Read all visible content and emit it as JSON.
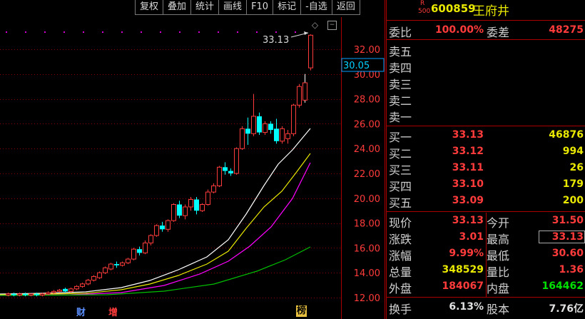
{
  "toolbar": {
    "buttons": [
      "复权",
      "叠加",
      "统计",
      "画线",
      "F10",
      "标记",
      "-自选",
      "返回"
    ]
  },
  "chart": {
    "peak_label": "33.13",
    "current_price_tag": "30.05",
    "y_ticks": [
      "32.00",
      "30.00",
      "28.00",
      "26.00",
      "24.00",
      "22.00",
      "20.00",
      "18.00",
      "16.00",
      "14.00",
      "12.00"
    ],
    "event_badges": [
      "财",
      "增",
      "榜"
    ]
  },
  "colors": {
    "up": "#ff3b3b",
    "down": "#00ffff",
    "ma_white": "#ffffff",
    "ma_yellow": "#e8e800",
    "ma_magenta": "#ff00ff",
    "ma_green": "#00c000",
    "grid": "#8b0000"
  },
  "quote": {
    "r_label": "R",
    "r_sub": "500",
    "code": "600859",
    "name": "王府井",
    "weibi_label": "委比",
    "weibi_value": "100.00%",
    "weicha_label": "委差",
    "weicha_value": "48275",
    "sell": [
      {
        "label": "卖五"
      },
      {
        "label": "卖四"
      },
      {
        "label": "卖三"
      },
      {
        "label": "卖二"
      },
      {
        "label": "卖一"
      }
    ],
    "buy": [
      {
        "label": "买一",
        "price": "33.13",
        "vol": "46876"
      },
      {
        "label": "买二",
        "price": "33.12",
        "vol": "994"
      },
      {
        "label": "买三",
        "price": "33.11",
        "vol": "26"
      },
      {
        "label": "买四",
        "price": "33.10",
        "vol": "179"
      },
      {
        "label": "买五",
        "price": "33.09",
        "vol": "200"
      }
    ],
    "stats": [
      {
        "l1": "现价",
        "v1": "33.13",
        "c1": "red",
        "l2": "今开",
        "v2": "31.50",
        "c2": "red"
      },
      {
        "l1": "涨跌",
        "v1": "3.01",
        "c1": "red",
        "l2": "最高",
        "v2": "33.13",
        "c2": "red"
      },
      {
        "l1": "涨幅",
        "v1": "9.99%",
        "c1": "red",
        "l2": "最低",
        "v2": "30.60",
        "c2": "red"
      },
      {
        "l1": "总量",
        "v1": "348529",
        "c1": "yellow",
        "l2": "量比",
        "v2": "1.36",
        "c2": "red"
      },
      {
        "l1": "外盘",
        "v1": "184067",
        "c1": "red",
        "l2": "内盘",
        "v2": "164462",
        "c2": "green"
      },
      {
        "l1": "换手",
        "v1": "6.13%",
        "c1": "white",
        "l2": "股本",
        "v2": "7.76亿",
        "c2": "white"
      }
    ]
  }
}
